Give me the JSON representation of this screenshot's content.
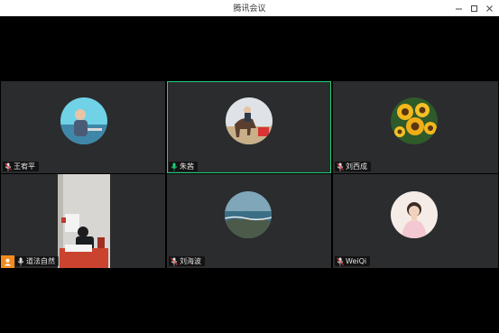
{
  "window": {
    "title": "腾讯会议"
  },
  "window_controls": [
    {
      "id": "minimize",
      "icon": "minimize-icon",
      "glyph": "—"
    },
    {
      "id": "maximize",
      "icon": "maximize-icon",
      "glyph": "☐"
    },
    {
      "id": "close",
      "icon": "close-icon",
      "glyph": "✕"
    }
  ],
  "participants": [
    {
      "name": "王宥平",
      "mic": "muted",
      "avatar": "child-photo-avatar"
    },
    {
      "name": "朱茜",
      "mic": "active",
      "avatar": "horse-riding-photo-avatar",
      "speaking": true
    },
    {
      "name": "刘西成",
      "mic": "muted",
      "avatar": "sunflower-avatar"
    },
    {
      "name": "道法自然",
      "mic": "muted",
      "avatar": "video-feed",
      "host": true
    },
    {
      "name": "刘海波",
      "mic": "muted",
      "avatar": "seascape-avatar"
    },
    {
      "name": "WeiQi",
      "mic": "muted",
      "avatar": "girl-photo-avatar"
    }
  ],
  "colors": {
    "active_speaker": "#1fd07a",
    "host_badge": "#f28a1f",
    "tile_bg": "#2b2c2e"
  }
}
